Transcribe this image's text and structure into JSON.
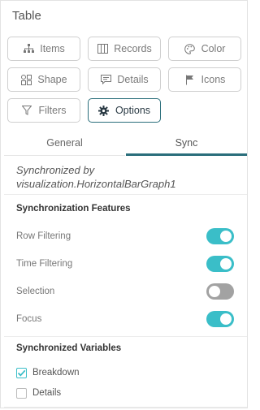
{
  "panel": {
    "title": "Table"
  },
  "buttons": [
    {
      "label": "Items",
      "icon": "hierarchy-icon"
    },
    {
      "label": "Records",
      "icon": "columns-icon"
    },
    {
      "label": "Color",
      "icon": "palette-icon"
    },
    {
      "label": "Shape",
      "icon": "shapes-icon"
    },
    {
      "label": "Details",
      "icon": "speech-bubble-icon"
    },
    {
      "label": "Icons",
      "icon": "flag-icon"
    },
    {
      "label": "Filters",
      "icon": "funnel-icon"
    },
    {
      "label": "Options",
      "icon": "gear-icon",
      "active": true
    }
  ],
  "tabs": {
    "general": "General",
    "sync": "Sync",
    "selected": "Sync"
  },
  "sync": {
    "synced_line1": "Synchronized by",
    "synced_line2": "visualization.HorizontalBarGraph1",
    "features_title": "Synchronization Features",
    "features": [
      {
        "label": "Row Filtering",
        "on": true
      },
      {
        "label": "Time Filtering",
        "on": true
      },
      {
        "label": "Selection",
        "on": false
      },
      {
        "label": "Focus",
        "on": true
      }
    ],
    "variables_title": "Synchronized Variables",
    "variables": [
      {
        "label": "Breakdown",
        "checked": true
      },
      {
        "label": "Details",
        "checked": false
      }
    ]
  },
  "colors": {
    "accent": "#3abec8",
    "active_border": "#2a6e7b",
    "toggle_off": "#a2a2a2"
  }
}
